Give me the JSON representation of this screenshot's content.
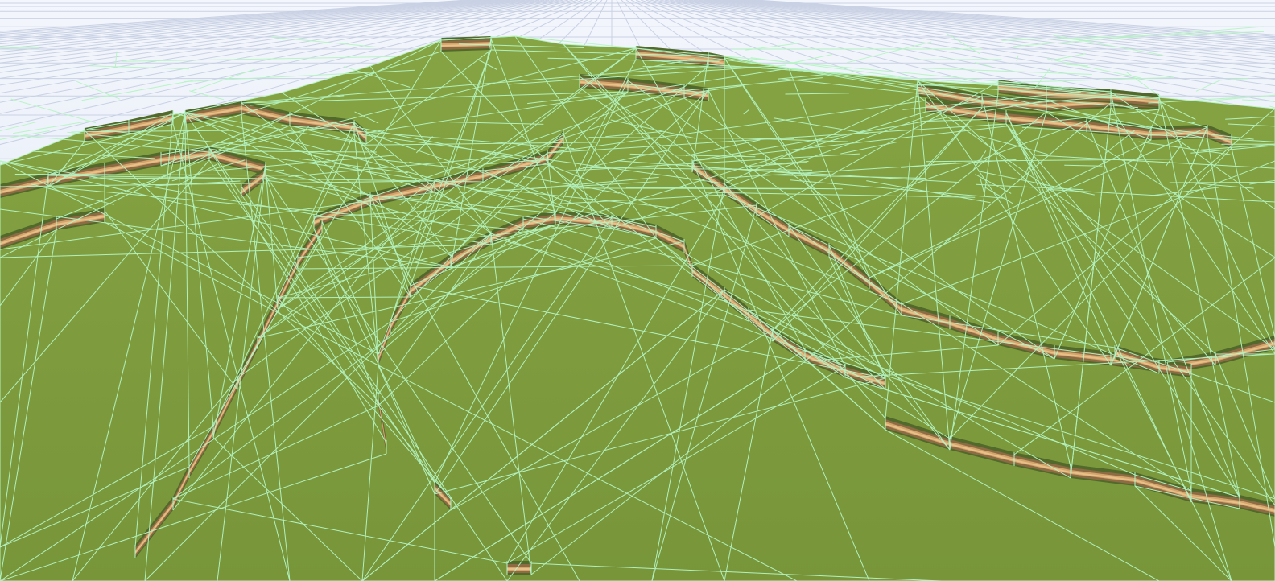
{
  "scene": {
    "view": "3d-wireframe-terrain-mesh",
    "colors": {
      "sky_grid_background": "#e9eef9",
      "grid_line": "#c9d1e4",
      "terrain_top": "#7d9a3a",
      "terrain_top_far": "#86a443",
      "cliff_band_dark": "#51692a",
      "cliff_band_brown": "#8d6b45",
      "cliff_band_tan": "#d4a56a",
      "cliff_band_light": "#e8c08a",
      "wireframe": "#b6f5c4"
    },
    "elements": [
      "ground-grid",
      "terrain-plateau",
      "cliff-edges",
      "wireframe-overlay"
    ]
  }
}
